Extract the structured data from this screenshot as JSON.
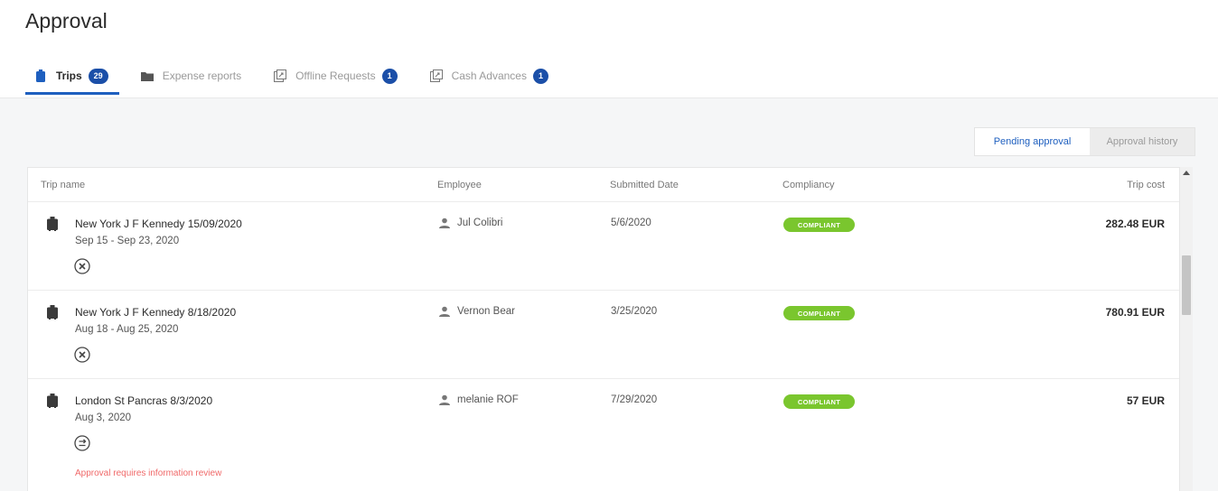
{
  "page": {
    "title": "Approval"
  },
  "tabs": [
    {
      "label": "Trips",
      "badge": "29",
      "icon": "luggage-icon",
      "active": true
    },
    {
      "label": "Expense reports",
      "badge": "",
      "icon": "folder-icon",
      "active": false
    },
    {
      "label": "Offline Requests",
      "badge": "1",
      "icon": "external-link-icon",
      "active": false
    },
    {
      "label": "Cash Advances",
      "badge": "1",
      "icon": "external-link-icon",
      "active": false
    }
  ],
  "toggle": {
    "pending": "Pending approval",
    "history": "Approval history"
  },
  "table": {
    "headers": {
      "trip_name": "Trip name",
      "employee": "Employee",
      "submitted": "Submitted Date",
      "compliancy": "Compliancy",
      "cost": "Trip cost"
    },
    "rows": [
      {
        "title": "New York J F Kennedy 15/09/2020",
        "dates": "Sep 15 - Sep 23, 2020",
        "employee": "Jul Colibri",
        "submitted": "5/6/2020",
        "compliance": "COMPLIANT",
        "cost": "282.48 EUR",
        "status_icon": "circle-x-icon"
      },
      {
        "title": "New York J F Kennedy 8/18/2020",
        "dates": "Aug 18 - Aug 25, 2020",
        "employee": "Vernon Bear",
        "submitted": "3/25/2020",
        "compliance": "COMPLIANT",
        "cost": "780.91 EUR",
        "status_icon": "circle-x-icon"
      },
      {
        "title": "London St Pancras 8/3/2020",
        "dates": "Aug 3, 2020",
        "employee": "melanie ROF",
        "submitted": "7/29/2020",
        "compliance": "COMPLIANT",
        "cost": "57 EUR",
        "status_icon": "circle-arrow-icon",
        "warning": "Approval requires information review"
      }
    ]
  },
  "colors": {
    "accent": "#1e5fbf",
    "badge": "#1b4fa8",
    "compliant": "#7ac62e",
    "warning": "#f06a6a"
  }
}
